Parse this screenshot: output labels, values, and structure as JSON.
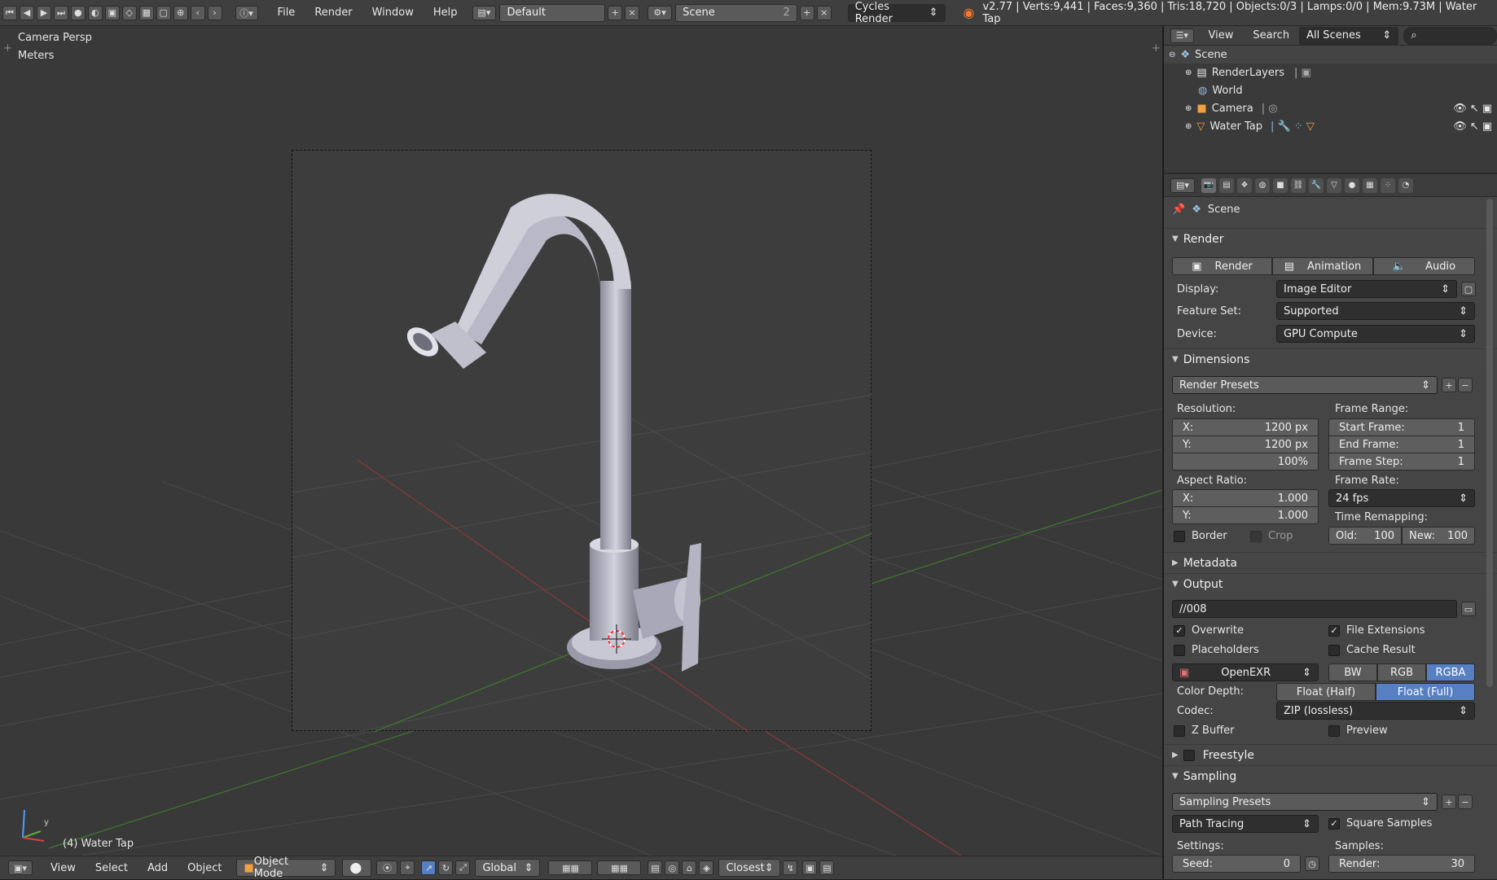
{
  "topbar": {
    "menus": [
      "File",
      "Render",
      "Window",
      "Help"
    ],
    "screen_layout": "Default",
    "scene": "Scene",
    "scene_users": "2",
    "engine": "Cycles Render",
    "stats": "v2.77 | Verts:9,441 | Faces:9,360 | Tris:18,720 | Objects:0/3 | Lamps:0/0 | Mem:9.73M | Water Tap"
  },
  "viewport": {
    "view_name": "Camera Persp",
    "units": "Meters",
    "active_object": "(4) Water Tap",
    "axis_y": "y",
    "axis_x": "x"
  },
  "viewport_header": {
    "menus": [
      "View",
      "Select",
      "Add",
      "Object"
    ],
    "mode": "Object Mode",
    "orientation": "Global",
    "snap": "Closest"
  },
  "outliner": {
    "menus": [
      "View",
      "Search"
    ],
    "display_mode": "All Scenes",
    "items": [
      {
        "label": "Scene",
        "icon": "scene-icon"
      },
      {
        "label": "RenderLayers",
        "icon": "renderlayers-icon"
      },
      {
        "label": "World",
        "icon": "world-icon"
      },
      {
        "label": "Camera",
        "icon": "camera-icon"
      },
      {
        "label": "Water Tap",
        "icon": "mesh-icon"
      }
    ]
  },
  "properties": {
    "context": "Scene",
    "render": {
      "title": "Render",
      "buttons": [
        "Render",
        "Animation",
        "Audio"
      ],
      "display_label": "Display:",
      "display_value": "Image Editor",
      "feature_label": "Feature Set:",
      "feature_value": "Supported",
      "device_label": "Device:",
      "device_value": "GPU Compute"
    },
    "dimensions": {
      "title": "Dimensions",
      "presets": "Render Presets",
      "resolution_label": "Resolution:",
      "res_x_label": "X:",
      "res_x": "1200 px",
      "res_y_label": "Y:",
      "res_y": "1200 px",
      "res_pct": "100%",
      "frame_range_label": "Frame Range:",
      "start_label": "Start Frame:",
      "start": "1",
      "end_label": "End Frame:",
      "end": "1",
      "step_label": "Frame Step:",
      "step": "1",
      "aspect_label": "Aspect Ratio:",
      "asp_x_label": "X:",
      "asp_x": "1.000",
      "asp_y_label": "Y:",
      "asp_y": "1.000",
      "frame_rate_label": "Frame Rate:",
      "frame_rate": "24 fps",
      "time_remap_label": "Time Remapping:",
      "old_label": "Old:",
      "old": "100",
      "new_label": "New:",
      "new": "100",
      "border": "Border",
      "crop": "Crop"
    },
    "metadata_title": "Metadata",
    "output": {
      "title": "Output",
      "path": "//008",
      "overwrite": "Overwrite",
      "file_ext": "File Extensions",
      "placeholders": "Placeholders",
      "cache": "Cache Result",
      "format": "OpenEXR",
      "bw": "BW",
      "rgb": "RGB",
      "rgba": "RGBA",
      "depth_label": "Color Depth:",
      "half": "Float (Half)",
      "full": "Float (Full)",
      "codec_label": "Codec:",
      "codec": "ZIP (lossless)",
      "zbuffer": "Z Buffer",
      "preview": "Preview"
    },
    "freestyle_title": "Freestyle",
    "sampling": {
      "title": "Sampling",
      "presets": "Sampling Presets",
      "integrator": "Path Tracing",
      "square": "Square Samples",
      "settings_label": "Settings:",
      "samples_label": "Samples:",
      "seed_label": "Seed:",
      "seed": "0",
      "render_label": "Render:",
      "render": "30"
    }
  }
}
